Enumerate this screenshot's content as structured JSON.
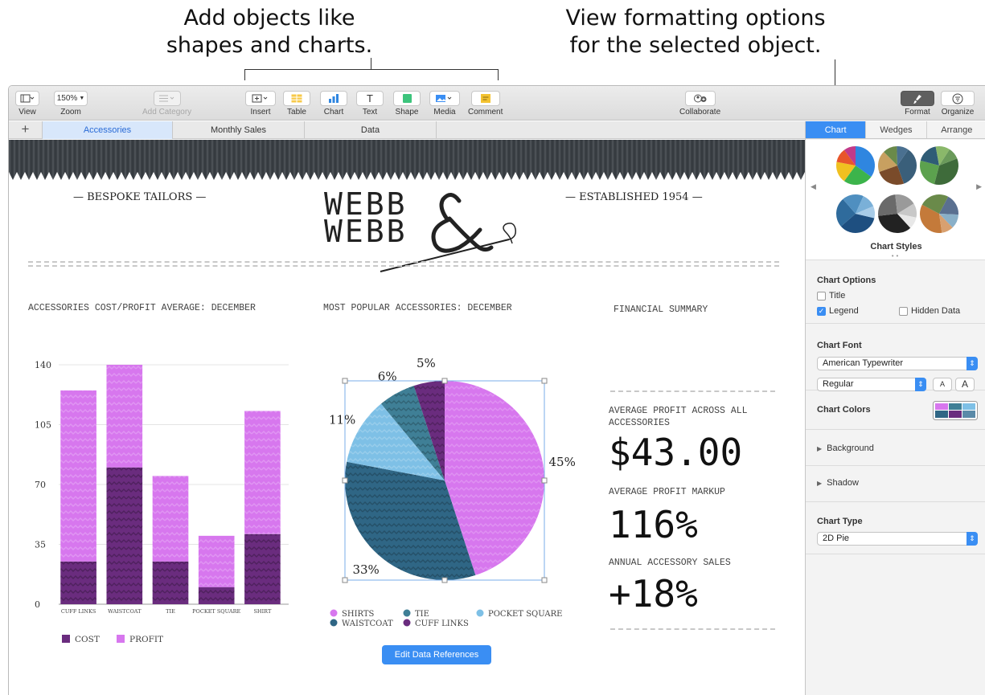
{
  "callouts": {
    "left": [
      "Add objects like",
      "shapes and charts."
    ],
    "right": [
      "View formatting options",
      "for the selected object."
    ]
  },
  "toolbar": {
    "view": "View",
    "zoom_value": "150%",
    "zoom": "Zoom",
    "add_category": "Add Category",
    "insert": "Insert",
    "table": "Table",
    "chart": "Chart",
    "text": "Text",
    "shape": "Shape",
    "media": "Media",
    "comment": "Comment",
    "collaborate": "Collaborate",
    "format": "Format",
    "organize": "Organize"
  },
  "sheets": {
    "add": "+",
    "tabs": [
      "Accessories",
      "Monthly Sales",
      "Data"
    ]
  },
  "sidebar": {
    "tabs": [
      "Chart",
      "Wedges",
      "Arrange"
    ],
    "styles_label": "Chart Styles",
    "chart_options": {
      "title": "Chart Options",
      "title_cb": "Title",
      "legend_cb": "Legend",
      "hidden_cb": "Hidden Data",
      "title_checked": false,
      "legend_checked": true,
      "hidden_checked": false
    },
    "chart_font": {
      "title": "Chart Font",
      "family": "American Typewriter",
      "style": "Regular",
      "smaller": "A",
      "larger": "A"
    },
    "chart_colors": "Chart Colors",
    "background": "Background",
    "shadow": "Shadow",
    "chart_type": {
      "title": "Chart Type",
      "value": "2D Pie"
    }
  },
  "doc": {
    "left_tagline": "— BESPOKE TAILORS —",
    "right_tagline": "— ESTABLISHED 1954 —",
    "logo_words": [
      "WEBB",
      "WEBB"
    ],
    "bar_title": "ACCESSORIES COST/PROFIT AVERAGE: DECEMBER",
    "pie_title": "MOST POPULAR ACCESSORIES: DECEMBER",
    "summary_title": "FINANCIAL SUMMARY",
    "metric1_label": "AVERAGE PROFIT ACROSS ALL ACCESSORIES",
    "metric1_value": "$43.00",
    "metric2_label": "AVERAGE PROFIT MARKUP",
    "metric2_value": "116%",
    "metric3_label": "ANNUAL ACCESSORY SALES",
    "metric3_value": "+18%",
    "edit_button": "Edit Data References"
  },
  "chart_data": [
    {
      "type": "bar",
      "stacked": true,
      "title": "ACCESSORIES COST/PROFIT AVERAGE: DECEMBER",
      "categories": [
        "CUFF LINKS",
        "WAISTCOAT",
        "TIE",
        "POCKET SQUARE",
        "SHIRT"
      ],
      "series": [
        {
          "name": "COST",
          "color": "#6a2c7e",
          "values": [
            25,
            80,
            25,
            10,
            41
          ]
        },
        {
          "name": "PROFIT",
          "color": "#d777ee",
          "values": [
            100,
            60,
            50,
            30,
            72
          ]
        }
      ],
      "ylim": [
        0,
        140
      ],
      "yticks": [
        0,
        35,
        70,
        105,
        140
      ],
      "legend_position": "bottom-left",
      "grid": true
    },
    {
      "type": "pie",
      "title": "MOST POPULAR ACCESSORIES: DECEMBER",
      "slices": [
        {
          "name": "SHIRTS",
          "value": 45,
          "label": "45%",
          "color": "#d777ee"
        },
        {
          "name": "WAISTCOAT",
          "value": 33,
          "label": "33%",
          "color": "#2f6685"
        },
        {
          "name": "POCKET SQUARE",
          "value": 11,
          "label": "11%",
          "color": "#7ec0e6"
        },
        {
          "name": "TIE",
          "value": 6,
          "label": "6%",
          "color": "#3f7f96"
        },
        {
          "name": "CUFF LINKS",
          "value": 5,
          "label": "5%",
          "color": "#6a2c7e"
        }
      ],
      "legend_order": [
        "SHIRTS",
        "TIE",
        "POCKET SQUARE",
        "WAISTCOAT",
        "CUFF LINKS"
      ],
      "legend_position": "bottom",
      "selected": true
    }
  ]
}
